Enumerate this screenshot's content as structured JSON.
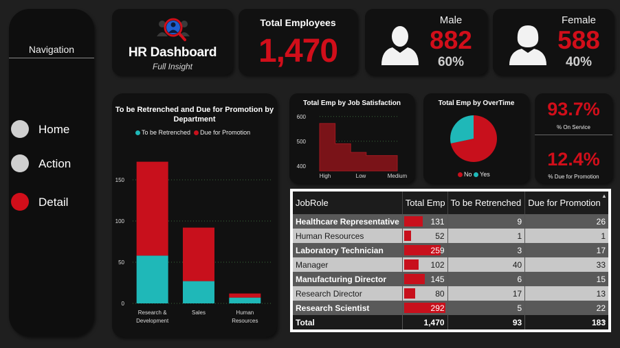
{
  "nav": {
    "title": "Navigation",
    "items": [
      {
        "label": "Home",
        "color": "#cfcfcf"
      },
      {
        "label": "Action",
        "color": "#cfcfcf"
      },
      {
        "label": "Detail",
        "color": "#d10e1a"
      }
    ]
  },
  "logo": {
    "title": "HR Dashboard",
    "subtitle": "Full Insight"
  },
  "kpi": {
    "total_label": "Total Employees",
    "total_value": "1,470",
    "male": {
      "label": "Male",
      "value": "882",
      "pct": "60%"
    },
    "female": {
      "label": "Female",
      "value": "588",
      "pct": "40%"
    }
  },
  "rates": {
    "on_service_value": "93.7%",
    "on_service_label": "% On Service",
    "due_promo_value": "12.4%",
    "due_promo_label": "% Due for Promotion"
  },
  "colors": {
    "accent": "#d10e1a",
    "teal": "#1fb8b8",
    "bar_red": "#c8101c"
  },
  "chart_data": [
    {
      "type": "bar",
      "title": "To be Retrenched and Due for Promotion by Department",
      "categories": [
        "Research & Development",
        "Sales",
        "Human Resources"
      ],
      "category_lines": [
        [
          "Research &",
          "Development"
        ],
        [
          "Sales"
        ],
        [
          "Human",
          "Resources"
        ]
      ],
      "series": [
        {
          "name": "To be Retrenched",
          "values": [
            58,
            27,
            7
          ],
          "color": "#1fb8b8"
        },
        {
          "name": "Due for Promotion",
          "values": [
            114,
            65,
            5
          ],
          "color": "#c8101c"
        }
      ],
      "stacked": true,
      "yticks": [
        0,
        50,
        100,
        150
      ],
      "ylim": [
        0,
        180
      ],
      "legend": "top"
    },
    {
      "type": "area",
      "title": "Total Emp by Job Satisfaction",
      "categories": [
        "High",
        "Low",
        "Medium"
      ],
      "values": [
        572,
        490,
        455
      ],
      "extra_steps": [
        442,
        442
      ],
      "yticks": [
        400,
        500,
        600
      ],
      "ylim": [
        380,
        605
      ],
      "color": "#7a1318"
    },
    {
      "type": "pie",
      "title": "Total Emp by OverTime",
      "slices": [
        {
          "name": "No",
          "value": 1054,
          "color": "#c8101c"
        },
        {
          "name": "Yes",
          "value": 416,
          "color": "#1fb8b8"
        }
      ],
      "legend": "bottom"
    }
  ],
  "table": {
    "columns": [
      "JobRole",
      "Total Emp",
      "To be Retrenched",
      "Due for Promotion"
    ],
    "rows": [
      {
        "role": "Healthcare Representative",
        "total": "131",
        "total_n": 131,
        "retrenched": "9",
        "promotion": "26"
      },
      {
        "role": "Human Resources",
        "total": "52",
        "total_n": 52,
        "retrenched": "1",
        "promotion": "1"
      },
      {
        "role": "Laboratory Technician",
        "total": "259",
        "total_n": 259,
        "retrenched": "3",
        "promotion": "17"
      },
      {
        "role": "Manager",
        "total": "102",
        "total_n": 102,
        "retrenched": "40",
        "promotion": "33"
      },
      {
        "role": "Manufacturing Director",
        "total": "145",
        "total_n": 145,
        "retrenched": "6",
        "promotion": "15"
      },
      {
        "role": "Research Director",
        "total": "80",
        "total_n": 80,
        "retrenched": "17",
        "promotion": "13"
      },
      {
        "role": "Research Scientist",
        "total": "292",
        "total_n": 292,
        "retrenched": "5",
        "promotion": "22"
      }
    ],
    "total_row": {
      "role": "Total",
      "total": "1,470",
      "retrenched": "93",
      "promotion": "183"
    }
  }
}
